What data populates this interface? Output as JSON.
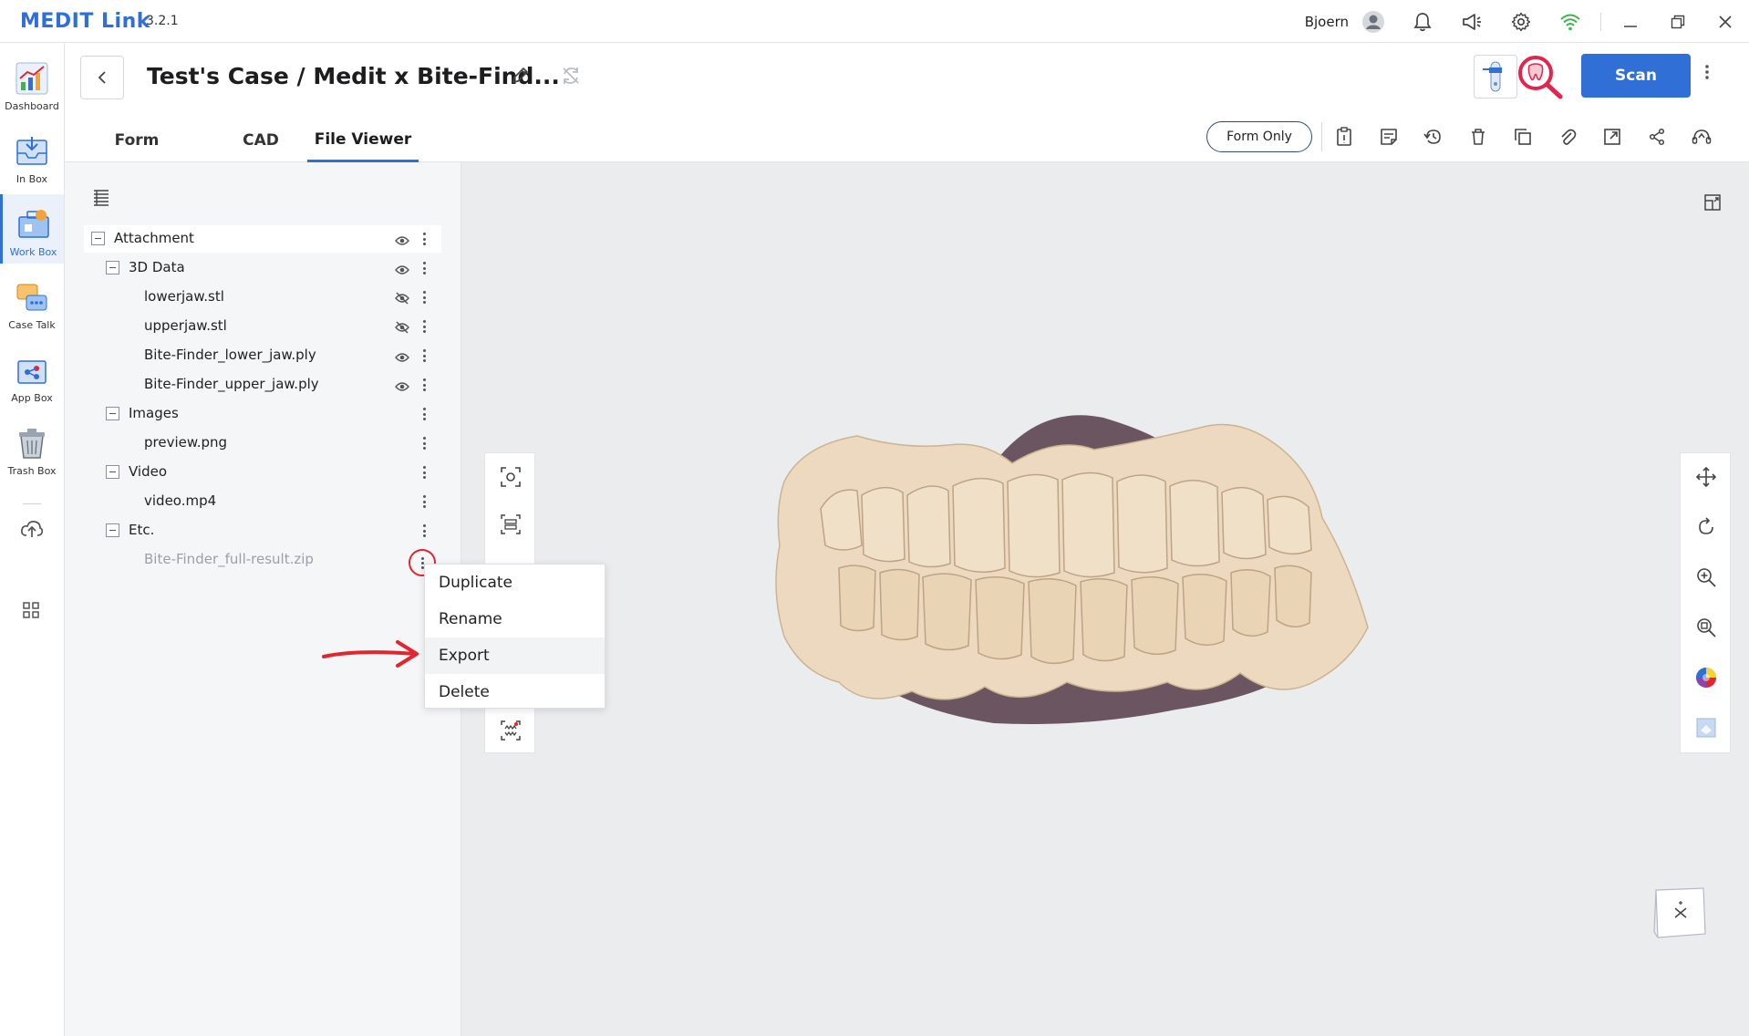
{
  "app": {
    "brand": "MEDIT Link",
    "version": "3.2.1",
    "user_name": "Bjoern",
    "accent_color": "#2f6fd6"
  },
  "nav": {
    "items": [
      {
        "label": "Dashboard",
        "icon": "dashboard-icon"
      },
      {
        "label": "In Box",
        "icon": "inbox-icon"
      },
      {
        "label": "Work Box",
        "icon": "workbox-icon",
        "active": true
      },
      {
        "label": "Case Talk",
        "icon": "casetalk-icon"
      },
      {
        "label": "App Box",
        "icon": "appbox-icon"
      },
      {
        "label": "Trash Box",
        "icon": "trashbox-icon"
      }
    ]
  },
  "header": {
    "case_title": "Test's Case / Medit x Bite-Find...",
    "scan_label": "Scan",
    "form_only_label": "Form Only",
    "tabs": [
      {
        "label": "Form"
      },
      {
        "label": "CAD"
      },
      {
        "label": "File Viewer",
        "active": true
      }
    ]
  },
  "tree": {
    "rows": [
      {
        "label": "Attachment",
        "level": 0,
        "box": true,
        "eye": "visible"
      },
      {
        "label": "3D Data",
        "level": 1,
        "box": true,
        "eye": "visible"
      },
      {
        "label": "lowerjaw.stl",
        "level": 2,
        "eye": "hidden"
      },
      {
        "label": "upperjaw.stl",
        "level": 2,
        "eye": "hidden"
      },
      {
        "label": "Bite-Finder_lower_jaw.ply",
        "level": 2,
        "eye": "visible"
      },
      {
        "label": "Bite-Finder_upper_jaw.ply",
        "level": 2,
        "eye": "visible"
      },
      {
        "label": "Images",
        "level": 1,
        "box": true
      },
      {
        "label": "preview.png",
        "level": 2
      },
      {
        "label": "Video",
        "level": 1,
        "box": true
      },
      {
        "label": "video.mp4",
        "level": 2
      },
      {
        "label": "Etc.",
        "level": 1,
        "box": true
      },
      {
        "label": "Bite-Finder_full-result.zip",
        "level": 2,
        "dim": true
      }
    ]
  },
  "context_menu": {
    "items": [
      {
        "label": "Duplicate"
      },
      {
        "label": "Rename"
      },
      {
        "label": "Export",
        "hover": true
      },
      {
        "label": "Delete"
      }
    ]
  }
}
